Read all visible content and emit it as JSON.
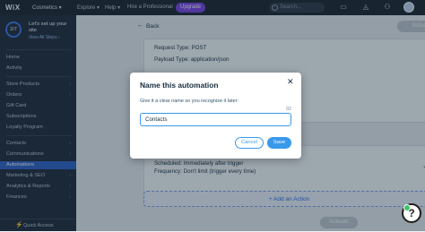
{
  "topbar": {
    "logo": "WiX",
    "site_name": "Cosmetics ▾",
    "nav": [
      "Explore ▾",
      "Help ▾",
      "Hire a Professional"
    ],
    "upgrade": "Upgrade",
    "search_placeholder": "Search...",
    "accent": "#7b3fe4"
  },
  "sidebar": {
    "progress": "2/7",
    "setup_title": "Let's set up your site",
    "setup_link": "View All Steps ›",
    "items": [
      "Home",
      "Activity",
      "Store Products",
      "Orders",
      "Gift Card",
      "Subscriptions",
      "Loyalty Program",
      "Contacts",
      "Communications",
      "Automations",
      "Marketing & SEO",
      "Analytics & Reports",
      "Finances"
    ],
    "active_index": 9,
    "quick_access": "Quick Access",
    "active_color": "#2f5fc9"
  },
  "main": {
    "back": "Back",
    "activate": "Activate",
    "request_type": "Request Type: POST",
    "payload_type": "Payload Type: application/json",
    "scheduled": "Scheduled: Immediately after trigger",
    "frequency": "Frequency: Don't limit (trigger every time)",
    "add_action": "+ Add an Action"
  },
  "modal": {
    "title": "Name this automation",
    "subtitle": "Give it a clear name so you recognize it later:",
    "char_count": "92",
    "input_value": "Contacts",
    "cancel": "Cancel",
    "save": "Save",
    "accent": "#3899ec"
  },
  "help": "?"
}
